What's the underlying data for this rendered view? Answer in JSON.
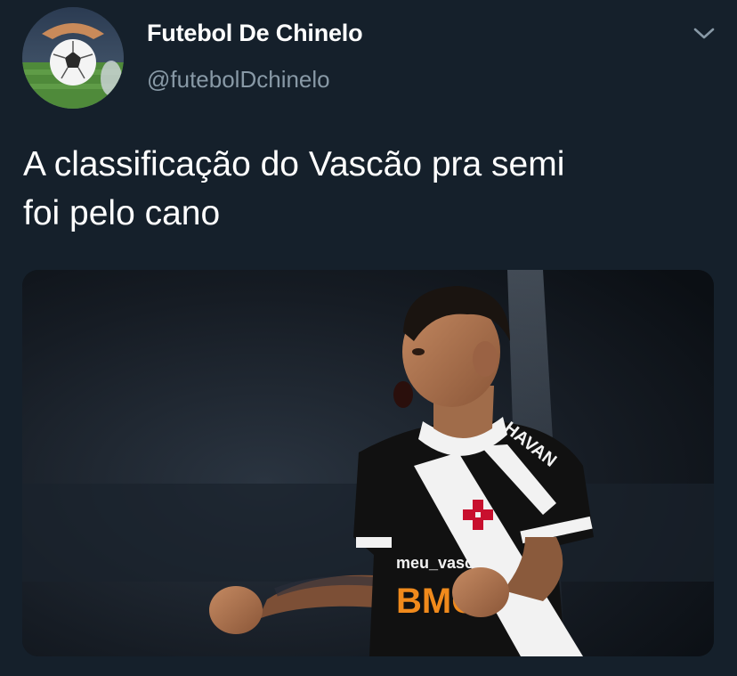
{
  "account": {
    "display_name": "Futebol De Chinelo",
    "handle": "@futebolDchinelo",
    "avatar_icon": "soccer-ball-avatar"
  },
  "menu": {
    "icon": "chevron-down-icon"
  },
  "tweet": {
    "text_line1": "A classificação do Vascão pra semi",
    "text_line2": "foi pelo cano"
  },
  "media": {
    "jersey_sponsor": "HAVAN",
    "jersey_chest": "meu_vasco",
    "jersey_main_sponsor": "BMG"
  },
  "colors": {
    "background": "#15202b",
    "text_primary": "#ffffff",
    "text_secondary": "#8899a6",
    "jersey_black": "#111111",
    "jersey_white": "#f2f2f2",
    "cross_red": "#c8102e",
    "sponsor_orange": "#f08a1c"
  }
}
